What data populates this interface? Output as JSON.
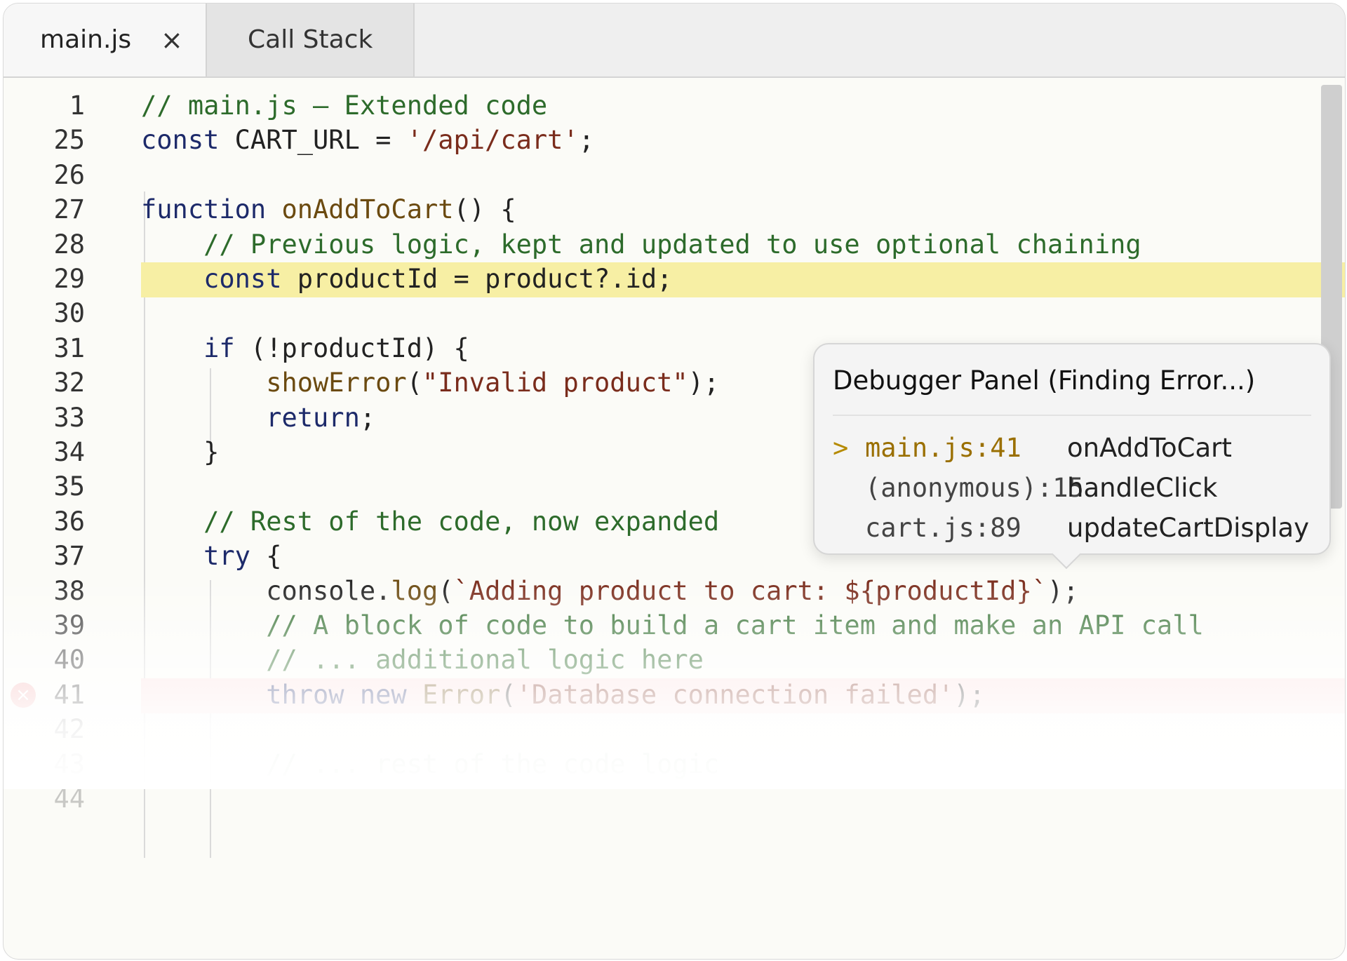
{
  "tabs": [
    {
      "label": "main.js",
      "close": "×",
      "active": true
    },
    {
      "label": "Call Stack",
      "active": false
    }
  ],
  "editor": {
    "lines": [
      {
        "num": "1",
        "parts": [
          {
            "t": "// main.js – Extended code",
            "c": "comment"
          }
        ]
      },
      {
        "num": "25",
        "parts": [
          {
            "t": "const ",
            "c": "kw"
          },
          {
            "t": "CART_URL = ",
            "c": "plain"
          },
          {
            "t": "'/api/cart'",
            "c": "str"
          },
          {
            "t": ";",
            "c": "plain"
          }
        ]
      },
      {
        "num": "26",
        "parts": []
      },
      {
        "num": "27",
        "parts": [
          {
            "t": "function ",
            "c": "kw"
          },
          {
            "t": "onAddToCart",
            "c": "fn"
          },
          {
            "t": "() {",
            "c": "plain"
          }
        ]
      },
      {
        "num": "28",
        "parts": [
          {
            "t": "    // Previous logic, kept and updated to use optional chaining",
            "c": "comment"
          }
        ]
      },
      {
        "num": "29",
        "highlight": "current",
        "parts": [
          {
            "t": "    const ",
            "c": "kw"
          },
          {
            "t": "productId = product?.id;",
            "c": "plain"
          }
        ]
      },
      {
        "num": "30",
        "parts": []
      },
      {
        "num": "31",
        "parts": [
          {
            "t": "    if ",
            "c": "kw"
          },
          {
            "t": "(!productId) {",
            "c": "plain"
          }
        ]
      },
      {
        "num": "32",
        "parts": [
          {
            "t": "        showError",
            "c": "fn"
          },
          {
            "t": "(",
            "c": "plain"
          },
          {
            "t": "\"Invalid product\"",
            "c": "str"
          },
          {
            "t": ");",
            "c": "plain"
          }
        ]
      },
      {
        "num": "33",
        "parts": [
          {
            "t": "        return",
            "c": "kw"
          },
          {
            "t": ";",
            "c": "plain"
          }
        ]
      },
      {
        "num": "34",
        "parts": [
          {
            "t": "    }",
            "c": "plain"
          }
        ]
      },
      {
        "num": "35",
        "parts": []
      },
      {
        "num": "36",
        "parts": [
          {
            "t": "    // Rest of the code, now expanded",
            "c": "comment"
          }
        ]
      },
      {
        "num": "37",
        "parts": [
          {
            "t": "    try ",
            "c": "kw"
          },
          {
            "t": "{",
            "c": "plain"
          }
        ]
      },
      {
        "num": "38",
        "parts": [
          {
            "t": "        console.",
            "c": "plain"
          },
          {
            "t": "log",
            "c": "fn"
          },
          {
            "t": "(",
            "c": "plain"
          },
          {
            "t": "`Adding product to cart: ${productId}`",
            "c": "str"
          },
          {
            "t": ");",
            "c": "plain"
          }
        ]
      },
      {
        "num": "39",
        "parts": [
          {
            "t": "        // A block of code to build a cart item and make an API call",
            "c": "comment"
          }
        ]
      },
      {
        "num": "40",
        "parts": [
          {
            "t": "        // ... additional logic here",
            "c": "comment"
          }
        ]
      },
      {
        "num": "41",
        "highlight": "error",
        "parts": [
          {
            "t": "        throw new ",
            "c": "kw"
          },
          {
            "t": "Error",
            "c": "fn"
          },
          {
            "t": "(",
            "c": "plain"
          },
          {
            "t": "'Database connection failed'",
            "c": "str"
          },
          {
            "t": ");",
            "c": "plain"
          }
        ]
      },
      {
        "num": "42",
        "parts": []
      },
      {
        "num": "43",
        "parts": [
          {
            "t": "        // ... rest of the code logic",
            "c": "comment"
          }
        ]
      },
      {
        "num": "44",
        "parts": []
      }
    ]
  },
  "debugger": {
    "title": "Debugger Panel (Finding Error...)",
    "frames": [
      {
        "marker": ">",
        "location": "main.js:41",
        "function": "onAddToCart",
        "active": true
      },
      {
        "marker": "",
        "location": "(anonymous):15",
        "function": "handleClick",
        "active": false
      },
      {
        "marker": "",
        "location": "cart.js:89",
        "function": "updateCartDisplay",
        "active": false
      }
    ]
  },
  "colors": {
    "current_line": "#f7efa4",
    "error_line": "#fbe0e0",
    "comment": "#2d6b2b",
    "keyword": "#1d2a6a",
    "function": "#6b4a10",
    "string": "#7a2c1c"
  },
  "icons": {
    "tab_close": "close-icon",
    "error_marker": "error-circle-icon",
    "frame_marker": "chevron-right-icon"
  }
}
